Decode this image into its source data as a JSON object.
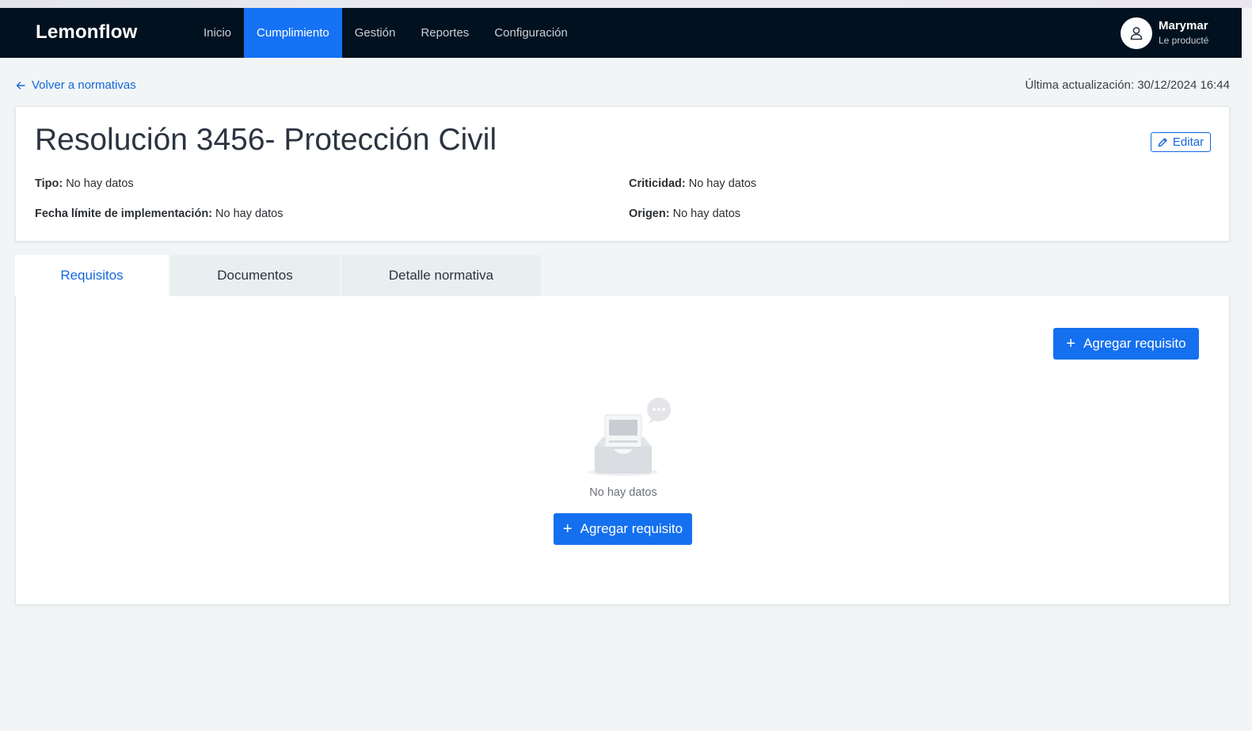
{
  "app": {
    "brand": "Lemonflow"
  },
  "nav": {
    "items": [
      {
        "label": "Inicio"
      },
      {
        "label": "Cumplimiento"
      },
      {
        "label": "Gestión"
      },
      {
        "label": "Reportes"
      },
      {
        "label": "Configuración"
      }
    ],
    "active": "Cumplimiento"
  },
  "user": {
    "name": "Marymar",
    "role": "Le producté",
    "icon": "user-icon"
  },
  "breadcrumb": {
    "back_label": "Volver a normativas",
    "icon": "arrow-left-icon"
  },
  "updated": "Última actualización: 30/12/2024 16:44",
  "regulation": {
    "title": "Resolución 3456- Protección Civil",
    "edit_label": "Editar",
    "edit_icon": "pencil-icon",
    "fields": {
      "tipo": {
        "label": "Tipo:",
        "value": "No hay datos"
      },
      "criticidad": {
        "label": "Criticidad:",
        "value": "No hay datos"
      },
      "fecha": {
        "label": "Fecha límite de implementación:",
        "value": "No hay datos"
      },
      "origen": {
        "label": "Origen:",
        "value": "No hay datos"
      }
    }
  },
  "tabs": [
    {
      "label": "Requisitos"
    },
    {
      "label": "Documentos"
    },
    {
      "label": "Detalle normativa"
    }
  ],
  "active_tab": "Requisitos",
  "requirements": {
    "add_label_top": "Agregar requisito",
    "empty_text": "No hay datos",
    "add_label_empty": "Agregar requisito",
    "empty_icon": "empty-inbox-icon"
  },
  "colors": {
    "nav_bg": "#02111f",
    "accent": "#1570ef",
    "link": "#1467dd"
  }
}
